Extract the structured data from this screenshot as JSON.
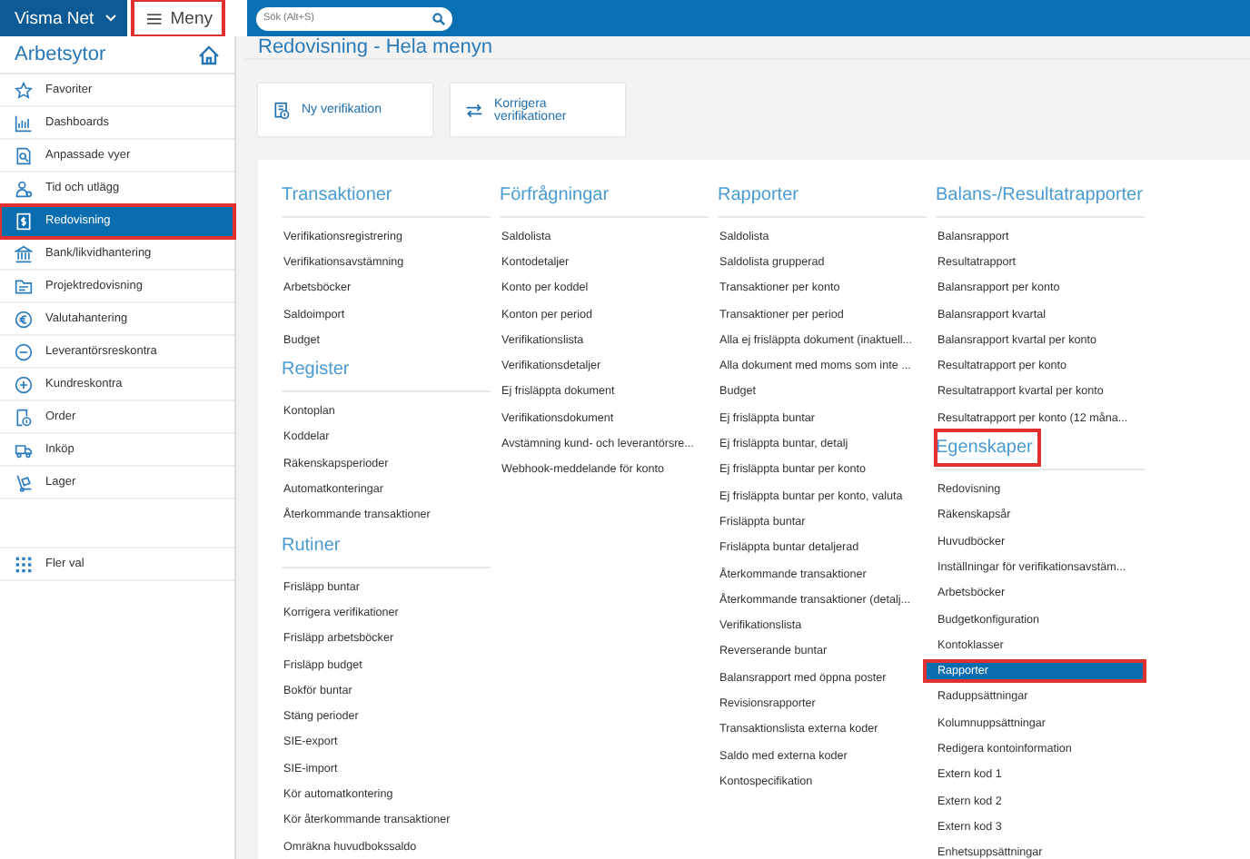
{
  "topbar": {
    "brand": "Visma Net",
    "menu_button": {
      "label": "Meny",
      "highlighted": true
    },
    "search": {
      "placeholder": "Sök (Alt+S)"
    }
  },
  "sidebar": {
    "title": "Arbetsytor",
    "items": [
      {
        "label": "Favoriter",
        "selected": false,
        "highlighted": false
      },
      {
        "label": "Dashboards",
        "selected": false,
        "highlighted": false
      },
      {
        "label": "Anpassade vyer",
        "selected": false,
        "highlighted": false
      },
      {
        "label": "Tid och utlägg",
        "selected": false,
        "highlighted": false
      },
      {
        "label": "Redovisning",
        "selected": true,
        "highlighted": true
      },
      {
        "label": "Bank/likvidhantering",
        "selected": false,
        "highlighted": false
      },
      {
        "label": "Projektredovisning",
        "selected": false,
        "highlighted": false
      },
      {
        "label": "Valutahantering",
        "selected": false,
        "highlighted": false
      },
      {
        "label": "Leverantörsreskontra",
        "selected": false,
        "highlighted": false
      },
      {
        "label": "Kundreskontra",
        "selected": false,
        "highlighted": false
      },
      {
        "label": "Order",
        "selected": false,
        "highlighted": false
      },
      {
        "label": "Inköp",
        "selected": false,
        "highlighted": false
      },
      {
        "label": "Lager",
        "selected": false,
        "highlighted": false
      }
    ],
    "more": "Fler val"
  },
  "page_title": "Redovisning - Hela menyn",
  "quick_actions": [
    "Ny verifikation",
    "Korrigera verifikationer"
  ],
  "columns": [
    {
      "sections": [
        {
          "heading": "Transaktioner",
          "highlighted": false,
          "items": [
            {
              "label": "Verifikationsregistrering",
              "selected": false,
              "highlighted": false
            },
            {
              "label": "Verifikationsavstämning",
              "selected": false,
              "highlighted": false
            },
            {
              "label": "Arbetsböcker",
              "selected": false,
              "highlighted": false
            },
            {
              "label": "Saldoimport",
              "selected": false,
              "highlighted": false
            },
            {
              "label": "Budget",
              "selected": false,
              "highlighted": false
            }
          ]
        },
        {
          "heading": "Register",
          "highlighted": false,
          "items": [
            {
              "label": "Kontoplan",
              "selected": false,
              "highlighted": false
            },
            {
              "label": "Koddelar",
              "selected": false,
              "highlighted": false
            },
            {
              "label": "Räkenskapsperioder",
              "selected": false,
              "highlighted": false
            },
            {
              "label": "Automatkonteringar",
              "selected": false,
              "highlighted": false
            },
            {
              "label": "Återkommande transaktioner",
              "selected": false,
              "highlighted": false
            }
          ]
        },
        {
          "heading": "Rutiner",
          "highlighted": false,
          "items": [
            {
              "label": "Frisläpp buntar",
              "selected": false,
              "highlighted": false
            },
            {
              "label": "Korrigera verifikationer",
              "selected": false,
              "highlighted": false
            },
            {
              "label": "Frisläpp arbetsböcker",
              "selected": false,
              "highlighted": false
            },
            {
              "label": "Frisläpp budget",
              "selected": false,
              "highlighted": false
            },
            {
              "label": "Bokför buntar",
              "selected": false,
              "highlighted": false
            },
            {
              "label": "Stäng perioder",
              "selected": false,
              "highlighted": false
            },
            {
              "label": "SIE-export",
              "selected": false,
              "highlighted": false
            },
            {
              "label": "SIE-import",
              "selected": false,
              "highlighted": false
            },
            {
              "label": "Kör automatkontering",
              "selected": false,
              "highlighted": false
            },
            {
              "label": "Kör återkommande transaktioner",
              "selected": false,
              "highlighted": false
            },
            {
              "label": "Omräkna huvudbokssaldo",
              "selected": false,
              "highlighted": false
            }
          ]
        }
      ]
    },
    {
      "sections": [
        {
          "heading": "Förfrågningar",
          "highlighted": false,
          "items": [
            {
              "label": "Saldolista",
              "selected": false,
              "highlighted": false
            },
            {
              "label": "Kontodetaljer",
              "selected": false,
              "highlighted": false
            },
            {
              "label": "Konto per koddel",
              "selected": false,
              "highlighted": false
            },
            {
              "label": "Konton per period",
              "selected": false,
              "highlighted": false
            },
            {
              "label": "Verifikationslista",
              "selected": false,
              "highlighted": false
            },
            {
              "label": "Verifikationsdetaljer",
              "selected": false,
              "highlighted": false
            },
            {
              "label": "Ej frisläppta dokument",
              "selected": false,
              "highlighted": false
            },
            {
              "label": "Verifikationsdokument",
              "selected": false,
              "highlighted": false
            },
            {
              "label": "Avstämning kund- och leverantörsre...",
              "selected": false,
              "highlighted": false
            },
            {
              "label": "Webhook-meddelande för konto",
              "selected": false,
              "highlighted": false
            }
          ]
        }
      ]
    },
    {
      "sections": [
        {
          "heading": "Rapporter",
          "highlighted": false,
          "items": [
            {
              "label": "Saldolista",
              "selected": false,
              "highlighted": false
            },
            {
              "label": "Saldolista grupperad",
              "selected": false,
              "highlighted": false
            },
            {
              "label": "Transaktioner per konto",
              "selected": false,
              "highlighted": false
            },
            {
              "label": "Transaktioner per period",
              "selected": false,
              "highlighted": false
            },
            {
              "label": "Alla ej frisläppta dokument (inaktuell...",
              "selected": false,
              "highlighted": false
            },
            {
              "label": "Alla dokument med moms som inte ...",
              "selected": false,
              "highlighted": false
            },
            {
              "label": "Budget",
              "selected": false,
              "highlighted": false
            },
            {
              "label": "Ej frisläppta buntar",
              "selected": false,
              "highlighted": false
            },
            {
              "label": "Ej frisläppta buntar, detalj",
              "selected": false,
              "highlighted": false
            },
            {
              "label": "Ej frisläppta buntar per konto",
              "selected": false,
              "highlighted": false
            },
            {
              "label": "Ej frisläppta buntar per konto, valuta",
              "selected": false,
              "highlighted": false
            },
            {
              "label": "Frisläppta buntar",
              "selected": false,
              "highlighted": false
            },
            {
              "label": "Frisläppta buntar detaljerad",
              "selected": false,
              "highlighted": false
            },
            {
              "label": "Återkommande transaktioner",
              "selected": false,
              "highlighted": false
            },
            {
              "label": "Återkommande transaktioner (detalj...",
              "selected": false,
              "highlighted": false
            },
            {
              "label": "Verifikationslista",
              "selected": false,
              "highlighted": false
            },
            {
              "label": "Reverserande buntar",
              "selected": false,
              "highlighted": false
            },
            {
              "label": "Balansrapport med öppna poster",
              "selected": false,
              "highlighted": false
            },
            {
              "label": "Revisionsrapporter",
              "selected": false,
              "highlighted": false
            },
            {
              "label": "Transaktionslista externa koder",
              "selected": false,
              "highlighted": false
            },
            {
              "label": "Saldo med externa koder",
              "selected": false,
              "highlighted": false
            },
            {
              "label": "Kontospecifikation",
              "selected": false,
              "highlighted": false
            }
          ]
        }
      ]
    },
    {
      "sections": [
        {
          "heading": "Balans-/Resultatrapporter",
          "highlighted": false,
          "items": [
            {
              "label": "Balansrapport",
              "selected": false,
              "highlighted": false
            },
            {
              "label": "Resultatrapport",
              "selected": false,
              "highlighted": false
            },
            {
              "label": "Balansrapport per konto",
              "selected": false,
              "highlighted": false
            },
            {
              "label": "Balansrapport kvartal",
              "selected": false,
              "highlighted": false
            },
            {
              "label": "Balansrapport kvartal per konto",
              "selected": false,
              "highlighted": false
            },
            {
              "label": "Resultatrapport per konto",
              "selected": false,
              "highlighted": false
            },
            {
              "label": "Resultatrapport kvartal per konto",
              "selected": false,
              "highlighted": false
            },
            {
              "label": "Resultatrapport per konto (12 måna...",
              "selected": false,
              "highlighted": false
            }
          ]
        },
        {
          "heading": "Egenskaper",
          "highlighted": true,
          "items": [
            {
              "label": "Redovisning",
              "selected": false,
              "highlighted": false
            },
            {
              "label": "Räkenskapsår",
              "selected": false,
              "highlighted": false
            },
            {
              "label": "Huvudböcker",
              "selected": false,
              "highlighted": false
            },
            {
              "label": "Inställningar för verifikationsavstäm...",
              "selected": false,
              "highlighted": false
            },
            {
              "label": "Arbetsböcker",
              "selected": false,
              "highlighted": false
            },
            {
              "label": "Budgetkonfiguration",
              "selected": false,
              "highlighted": false
            },
            {
              "label": "Kontoklasser",
              "selected": false,
              "highlighted": false
            },
            {
              "label": "Rapporter",
              "selected": true,
              "highlighted": true
            },
            {
              "label": "Raduppsättningar",
              "selected": false,
              "highlighted": false
            },
            {
              "label": "Kolumnuppsättningar",
              "selected": false,
              "highlighted": false
            },
            {
              "label": "Redigera kontoinformation",
              "selected": false,
              "highlighted": false
            },
            {
              "label": "Extern kod 1",
              "selected": false,
              "highlighted": false
            },
            {
              "label": "Extern kod 2",
              "selected": false,
              "highlighted": false
            },
            {
              "label": "Extern kod 3",
              "selected": false,
              "highlighted": false
            },
            {
              "label": "Enhetsuppsättningar",
              "selected": false,
              "highlighted": false
            }
          ]
        }
      ]
    }
  ]
}
